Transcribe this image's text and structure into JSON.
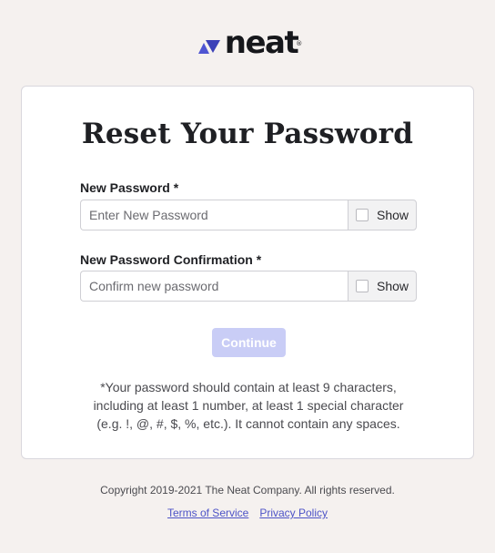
{
  "brand": {
    "name": "neat",
    "registered_mark": "®",
    "logo_icon": "neat-triangle-logo-icon",
    "accent_color": "#5257d6"
  },
  "form": {
    "title": "Reset Your Password",
    "new_password": {
      "label": "New Password *",
      "value": "",
      "placeholder": "Enter New Password",
      "show_label": "Show"
    },
    "confirm_password": {
      "label": "New Password Confirmation *",
      "value": "",
      "placeholder": "Confirm new password",
      "show_label": "Show"
    },
    "continue_label": "Continue",
    "continue_color": "#c9cdf6",
    "hint_lines": [
      "*Your password should contain at least 9 characters,",
      "including at least 1 number, at least 1 special character",
      "(e.g. !, @, #, $, %, etc.). It cannot contain any spaces."
    ]
  },
  "footer": {
    "copyright": "Copyright 2019-2021 The Neat Company. All rights reserved.",
    "links": {
      "terms": "Terms of Service",
      "privacy": "Privacy Policy"
    }
  }
}
